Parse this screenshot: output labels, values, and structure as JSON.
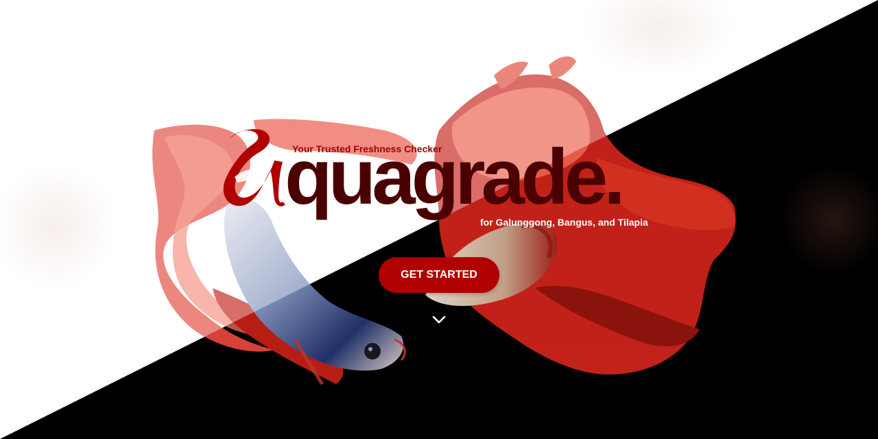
{
  "hero": {
    "tagline": "Your Trusted Freshness Checker",
    "brand_word": "quagrade.",
    "brand_letter": "a",
    "subtitle": "for Galunggong, Bangus, and Tilapia",
    "cta_label": "GET STARTED",
    "scroll_icon": "chevron-down-icon",
    "image_subject": "betta-fish"
  },
  "colors": {
    "accent": "#b00000",
    "brand_dark": "#4a0000",
    "tagline": "#a10000",
    "fish_red": "#d9261c",
    "fish_blue": "#2d3f7a",
    "light_bg": "#ffffff",
    "dark_bg": "#000000"
  }
}
